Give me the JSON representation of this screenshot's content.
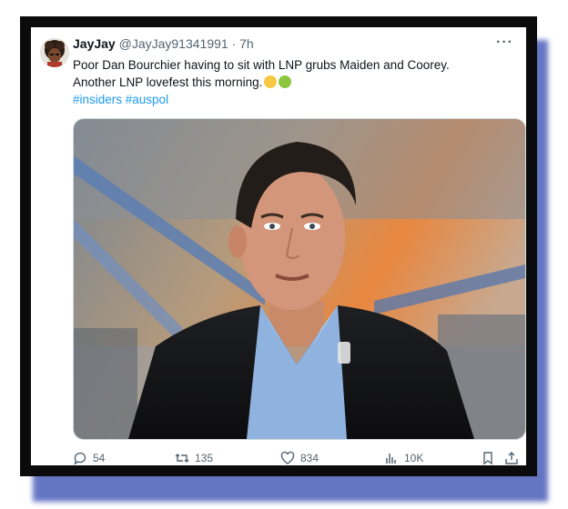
{
  "tweet": {
    "author_name": "JayJay",
    "handle": "@JayJay91341991",
    "separator": "·",
    "time": "7h",
    "more_label": "···",
    "text_line1": "Poor Dan Bourchier having to sit with LNP grubs Maiden and Coorey.",
    "text_line2": "Another LNP lovefest this morning.",
    "hashtags": "#insiders #auspol"
  },
  "actions": {
    "replies": "54",
    "retweets": "135",
    "likes": "834",
    "views": "10K"
  },
  "colors": {
    "link": "#1d9bf0",
    "muted": "#536471",
    "frame": "#0b0b0b",
    "shadow": "#4a5db8"
  }
}
